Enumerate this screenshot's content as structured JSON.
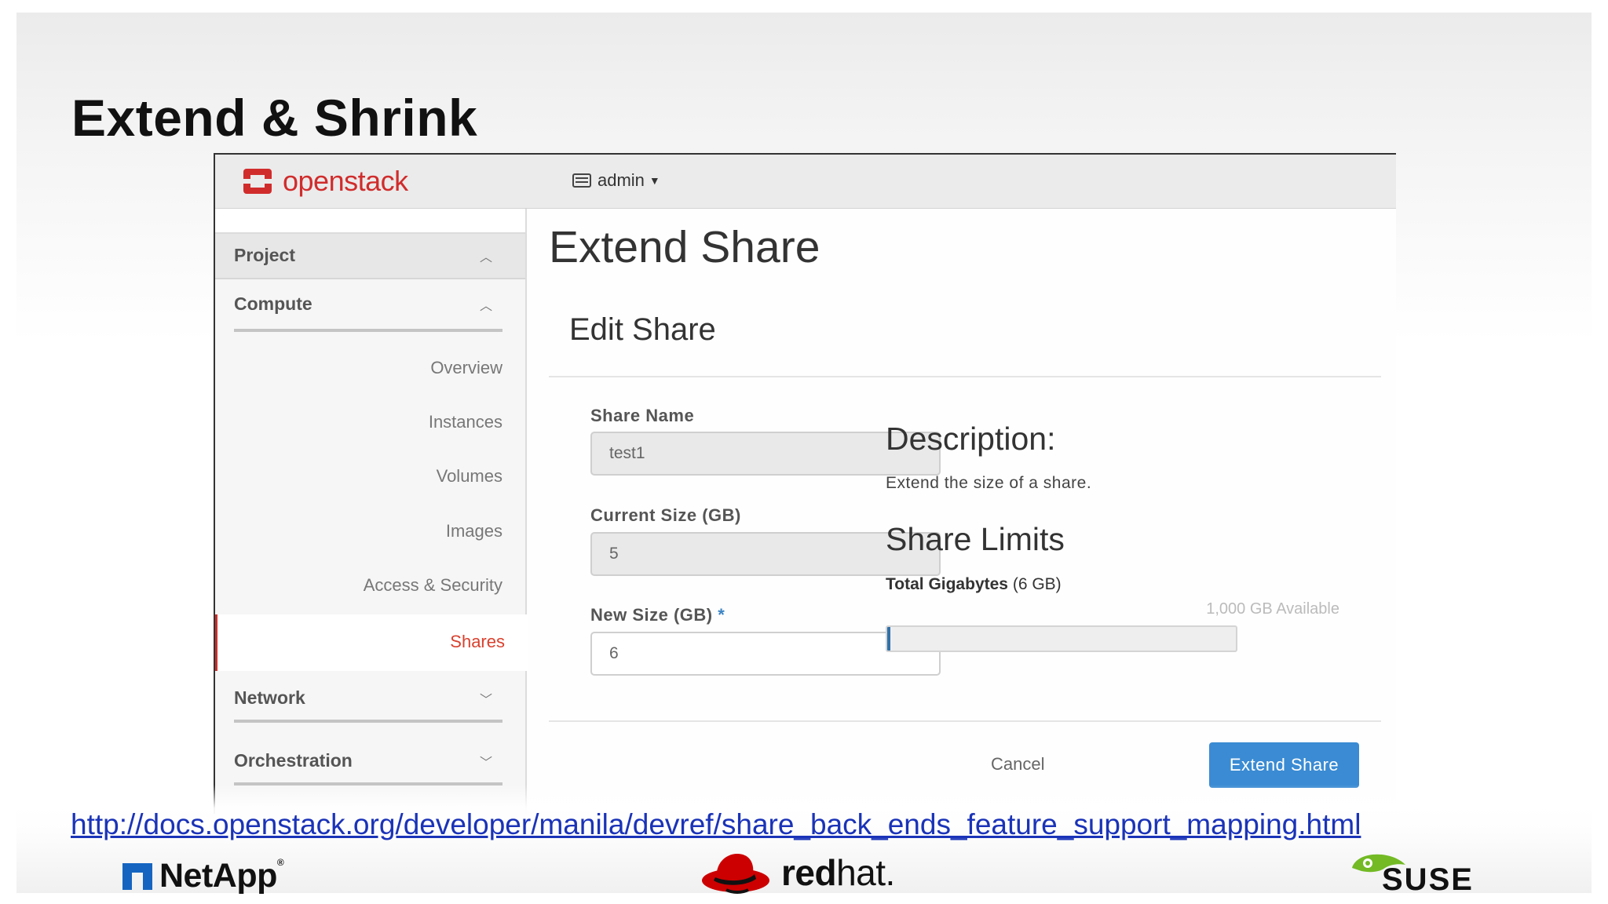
{
  "slide": {
    "title": "Extend & Shrink",
    "url": "http://docs.openstack.org/developer/manila/devref/share_back_ends_feature_support_mapping.html"
  },
  "topbar": {
    "logo_text": "openstack",
    "project_label": "admin"
  },
  "sidebar": {
    "project_label": "Project",
    "compute_label": "Compute",
    "items": [
      "Overview",
      "Instances",
      "Volumes",
      "Images",
      "Access & Security"
    ],
    "active_item": "Shares",
    "network_label": "Network",
    "orchestration_label": "Orchestration"
  },
  "main": {
    "page_title": "Extend Share",
    "section_title": "Edit Share",
    "share_name_label": "Share Name",
    "share_name_value": "test1",
    "current_size_label": "Current Size (GB)",
    "current_size_value": "5",
    "new_size_label": "New Size (GB)",
    "required_mark": "*",
    "new_size_value": "6",
    "description_heading": "Description:",
    "description_text": "Extend the size of a share.",
    "limits_heading": "Share Limits",
    "total_gigabytes_label": "Total Gigabytes",
    "total_gigabytes_value": "(6 GB)",
    "available_text": "1,000 GB Available",
    "usage_fraction": 0.006,
    "cancel_label": "Cancel",
    "submit_label": "Extend Share"
  },
  "logos": {
    "netapp": "NetApp",
    "redhat_bold": "red",
    "redhat_light": "hat.",
    "suse": "SUSE"
  },
  "colors": {
    "accent_red": "#d9412e",
    "primary_button": "#3a8bd3",
    "link": "#1a33b8"
  }
}
